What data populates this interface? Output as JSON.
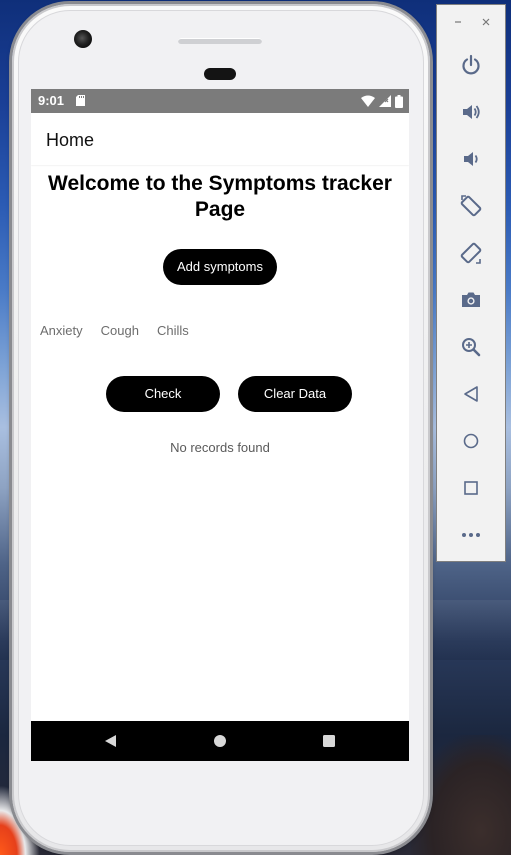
{
  "status_bar": {
    "time": "9:01"
  },
  "app_bar": {
    "title": "Home"
  },
  "main": {
    "heading": "Welcome to the Symptoms tracker Page",
    "add_symptoms_label": "Add symptoms",
    "symptoms": [
      "Anxiety",
      "Cough",
      "Chills"
    ],
    "check_label": "Check",
    "clear_data_label": "Clear Data",
    "empty_message": "No records found"
  },
  "nav_bar": {
    "back_icon": "triangle-back-icon",
    "home_icon": "circle-home-icon",
    "recent_icon": "square-recent-apps-icon"
  },
  "emulator_toolbar": {
    "window_controls": [
      "minimize-icon",
      "close-icon"
    ],
    "tools": [
      "power-icon",
      "volume-up-icon",
      "volume-down-icon",
      "rotate-left-icon",
      "rotate-right-icon",
      "camera-icon",
      "zoom-icon",
      "back-icon",
      "home-icon",
      "overview-icon",
      "more-icon"
    ]
  },
  "colors": {
    "status_bar": "#7b7b7b",
    "button": "#000000",
    "button_text": "#ffffff",
    "nav_bar": "#000000",
    "toolbar_icon": "#5a6a8a"
  }
}
